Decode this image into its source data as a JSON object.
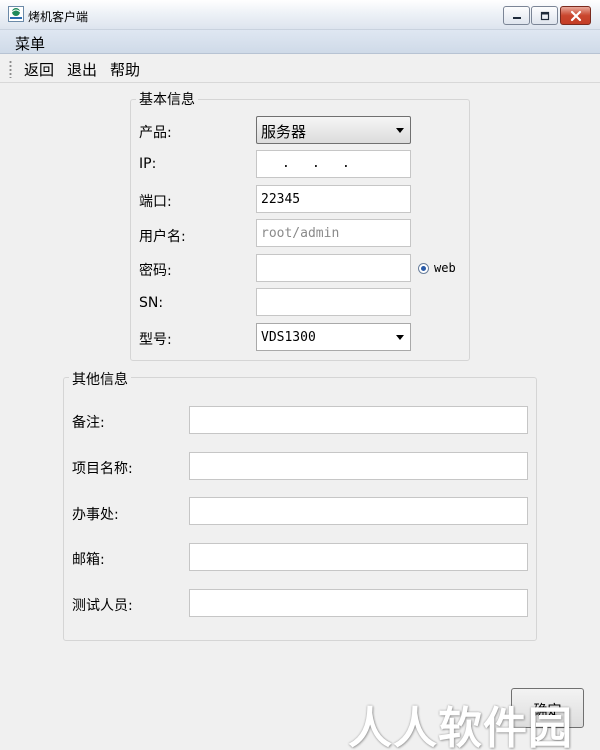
{
  "window": {
    "title": "烤机客户端"
  },
  "menubar": {
    "menu_label": "菜单"
  },
  "toolbar": {
    "back": "返回",
    "exit": "退出",
    "help": "帮助"
  },
  "basic": {
    "title": "基本信息",
    "product_label": "产品:",
    "product_value": "服务器",
    "ip_label": "IP:",
    "port_label": "端口:",
    "port_value": "22345",
    "user_label": "用户名:",
    "user_placeholder": "root/admin",
    "password_label": "密码:",
    "sn_label": "SN:",
    "model_label": "型号:",
    "model_value": "VDS1300",
    "web_label": "web"
  },
  "other": {
    "title": "其他信息",
    "remark_label": "备注:",
    "project_label": "项目名称:",
    "office_label": "办事处:",
    "email_label": "邮箱:",
    "tester_label": "测试人员:"
  },
  "footer": {
    "confirm": "确定"
  },
  "watermark": "人人软件园",
  "colors": {
    "close_button": "#c9462e",
    "radio_dot": "#2a5ba8"
  }
}
